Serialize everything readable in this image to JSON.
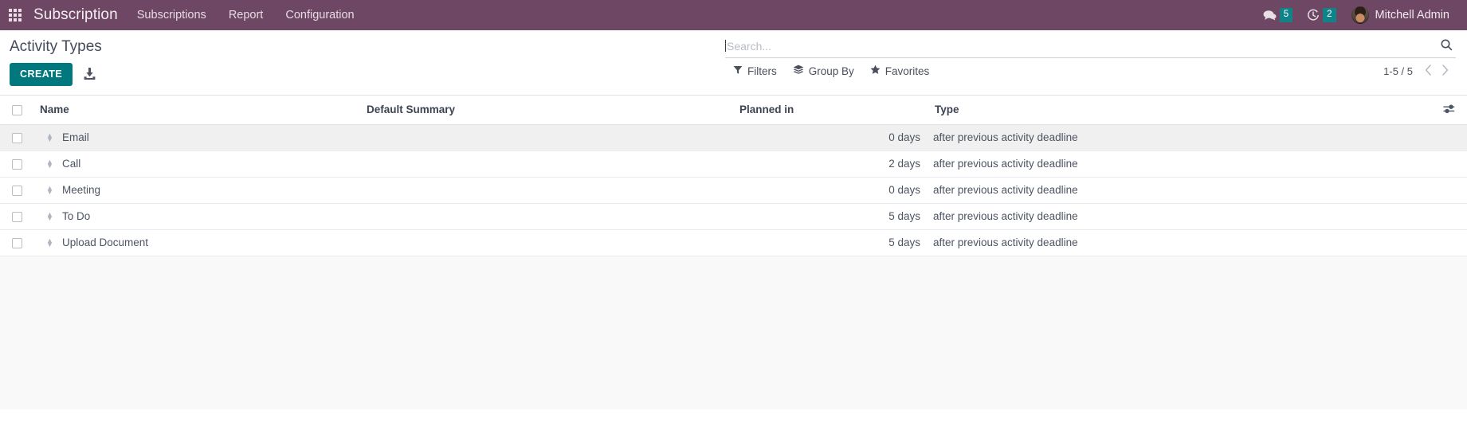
{
  "navbar": {
    "apps_icon": "apps-grid-icon",
    "brand": "Subscription",
    "menu": [
      {
        "label": "Subscriptions"
      },
      {
        "label": "Report"
      },
      {
        "label": "Configuration"
      }
    ],
    "systray": {
      "messages_icon": "messages-icon",
      "messages_count": "5",
      "activities_icon": "clock-activity-icon",
      "activities_count": "2",
      "avatar_icon": "user-avatar",
      "user_name": "Mitchell Admin"
    },
    "background_color": "#6d4763",
    "badge_color": "#0f8387"
  },
  "control_panel": {
    "title": "Activity Types",
    "create_label": "CREATE",
    "create_color": "#00787e",
    "import_icon": "import-download-icon",
    "search": {
      "value": "",
      "placeholder": "Search...",
      "search_icon": "search-icon"
    },
    "dropdowns": [
      {
        "label": "Filters",
        "icon": "filter-funnel-icon"
      },
      {
        "label": "Group By",
        "icon": "layers-icon"
      },
      {
        "label": "Favorites",
        "icon": "star-icon"
      }
    ],
    "pager": {
      "value": "1-5 / 5",
      "prev_icon": "chevron-left-icon",
      "next_icon": "chevron-right-icon"
    }
  },
  "list_view": {
    "select_all_icon": "checkbox",
    "optional_columns_icon": "column-options-icon",
    "columns": [
      {
        "label": "Name"
      },
      {
        "label": "Default Summary"
      },
      {
        "label": "Planned in"
      },
      {
        "label": "Type"
      }
    ],
    "rows": [
      {
        "name": "Email",
        "default_summary": "",
        "planned_in": "0 days",
        "type": "after previous activity deadline",
        "handle_icon": "drag-handle-icon",
        "highlighted": true
      },
      {
        "name": "Call",
        "default_summary": "",
        "planned_in": "2 days",
        "type": "after previous activity deadline",
        "handle_icon": "drag-handle-icon",
        "highlighted": false
      },
      {
        "name": "Meeting",
        "default_summary": "",
        "planned_in": "0 days",
        "type": "after previous activity deadline",
        "handle_icon": "drag-handle-icon",
        "highlighted": false
      },
      {
        "name": "To Do",
        "default_summary": "",
        "planned_in": "5 days",
        "type": "after previous activity deadline",
        "handle_icon": "drag-handle-icon",
        "highlighted": false
      },
      {
        "name": "Upload Document",
        "default_summary": "",
        "planned_in": "5 days",
        "type": "after previous activity deadline",
        "handle_icon": "drag-handle-icon",
        "highlighted": false
      }
    ]
  }
}
